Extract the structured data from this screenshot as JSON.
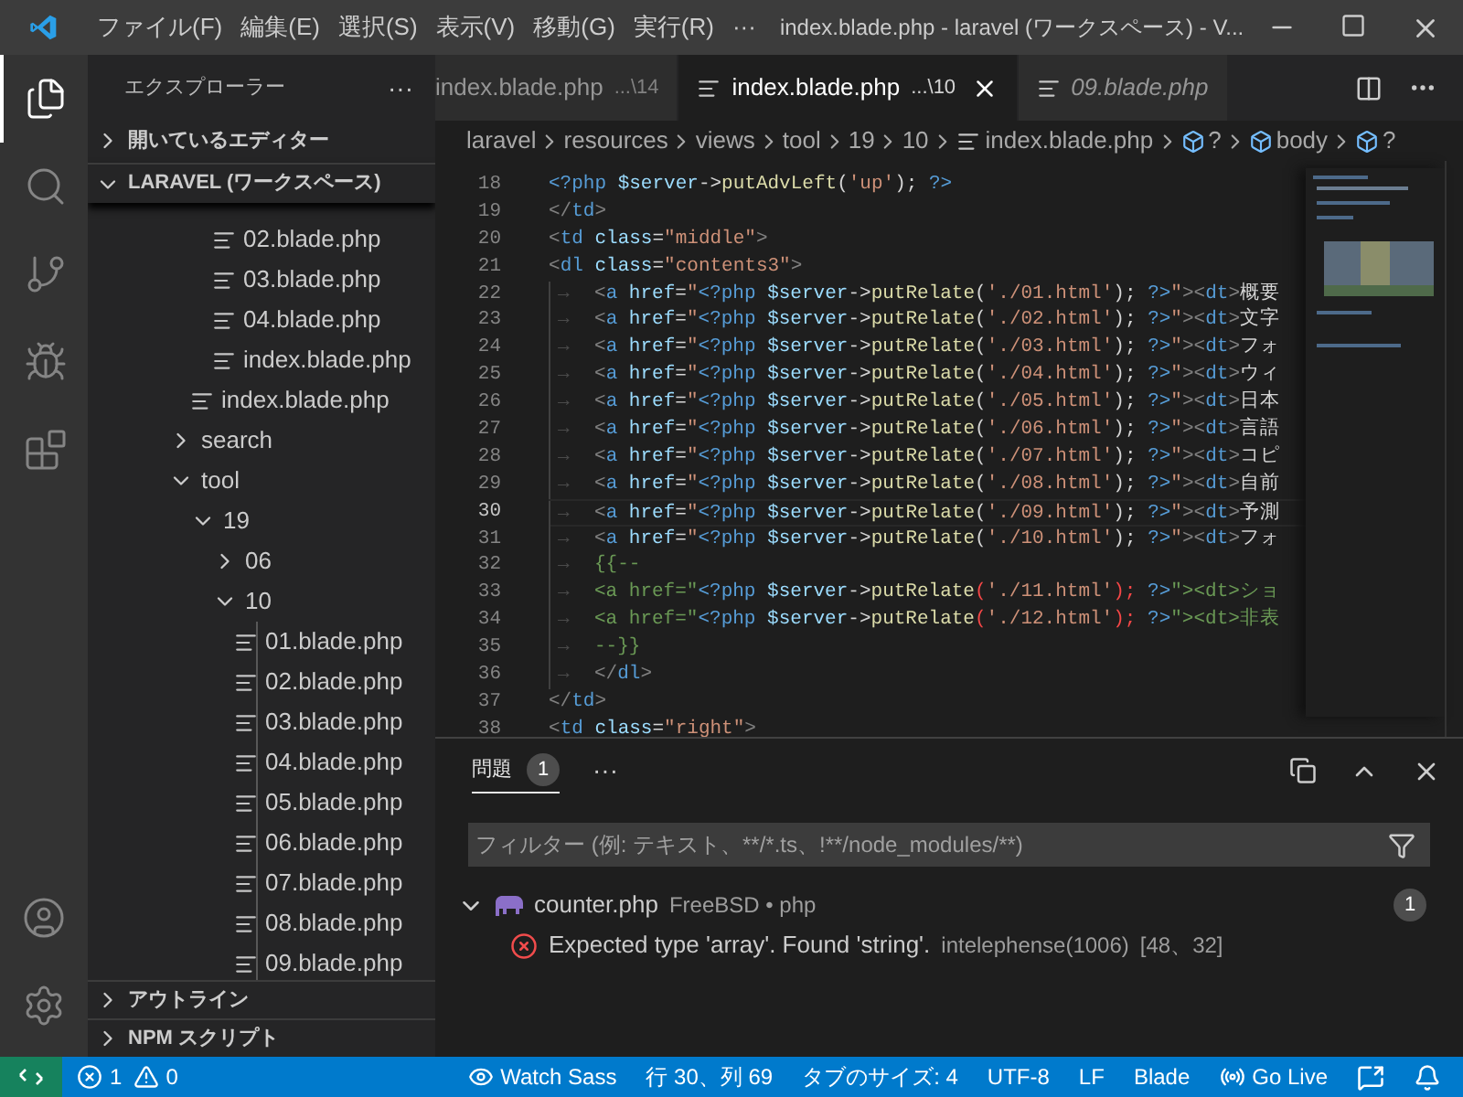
{
  "title_bar": {
    "menus": [
      {
        "label": "ファイル(F)"
      },
      {
        "label": "編集(E)"
      },
      {
        "label": "選択(S)"
      },
      {
        "label": "表示(V)"
      },
      {
        "label": "移動(G)"
      },
      {
        "label": "実行(R)"
      },
      {
        "label": "···"
      }
    ],
    "title": "index.blade.php - laravel (ワークスペース) - V..."
  },
  "activity_bar": {
    "items": [
      {
        "kind": "files",
        "selected": true
      },
      {
        "kind": "search",
        "selected": false
      },
      {
        "kind": "git",
        "selected": false
      },
      {
        "kind": "debug",
        "selected": false
      },
      {
        "kind": "extensions",
        "selected": false
      }
    ],
    "bottom": [
      {
        "kind": "account"
      },
      {
        "kind": "settings"
      }
    ]
  },
  "sidebar": {
    "title": "エクスプローラー",
    "more": "···",
    "open_editors": {
      "label": "開いているエディター",
      "expanded": false
    },
    "workspace": {
      "label": "LARAVEL (ワークスペース)",
      "expanded": true
    },
    "tree": [
      {
        "children": [
          {
            "children": [
              {
                "label": "02.blade.php"
              },
              {
                "label": "03.blade.php"
              },
              {
                "label": "04.blade.php"
              },
              {
                "label": "index.blade.php"
              }
            ]
          },
          {
            "label": "index.blade.php"
          }
        ]
      },
      {
        "label": "search",
        "expanded": false
      },
      {
        "label": "tool",
        "expanded": true,
        "children": [
          {
            "label": "19",
            "expanded": true,
            "children": [
              {
                "label": "06",
                "expanded": false
              },
              {
                "label": "10",
                "expanded": true,
                "children": [
                  {
                    "label": "01.blade.php"
                  },
                  {
                    "label": "02.blade.php"
                  },
                  {
                    "label": "03.blade.php"
                  },
                  {
                    "label": "04.blade.php"
                  },
                  {
                    "label": "05.blade.php"
                  },
                  {
                    "label": "06.blade.php"
                  },
                  {
                    "label": "07.blade.php"
                  },
                  {
                    "label": "08.blade.php"
                  },
                  {
                    "label": "09.blade.php"
                  }
                ]
              }
            ]
          }
        ]
      }
    ],
    "sections": [
      {
        "label": "アウトライン",
        "expanded": false
      },
      {
        "label": "NPM スクリプト",
        "expanded": false
      }
    ]
  },
  "tabs": [
    {
      "label": "index.blade.php",
      "path": "...\\14",
      "selected": false,
      "preview": false,
      "icon": false
    },
    {
      "label": "index.blade.php",
      "path": "...\\10",
      "selected": true,
      "preview": false,
      "icon": true
    },
    {
      "label": "09.blade.php",
      "selected": false,
      "preview": true,
      "icon": true
    }
  ],
  "breadcrumbs": [
    {
      "kind": "folder",
      "label": "laravel"
    },
    {
      "kind": "folder",
      "label": "resources"
    },
    {
      "kind": "folder",
      "label": "views"
    },
    {
      "kind": "folder",
      "label": "tool"
    },
    {
      "kind": "folder",
      "label": "19"
    },
    {
      "kind": "folder",
      "label": "10"
    },
    {
      "kind": "file",
      "label": "index.blade.php"
    },
    {
      "kind": "symbol",
      "label": "?"
    },
    {
      "kind": "symbol",
      "label": "body"
    },
    {
      "kind": "symbol",
      "label": "?"
    }
  ],
  "code": [
    {
      "number": "18",
      "current": false,
      "tokens": [
        {
          "kind": "keyword",
          "text": "<?php"
        },
        {
          "kind": "variable",
          "text": " $server"
        },
        {
          "kind": "operator",
          "text": "->"
        },
        {
          "kind": "function",
          "text": "putAdvLeft"
        },
        {
          "kind": "operator",
          "text": "("
        },
        {
          "kind": "string",
          "text": "'up'"
        },
        {
          "kind": "operator",
          "text": ");"
        },
        {
          "kind": "keyword",
          "text": " ?>"
        }
      ]
    },
    {
      "number": "19",
      "current": false,
      "tokens": [
        {
          "kind": "punct",
          "text": "</"
        },
        {
          "kind": "tag",
          "text": "td"
        },
        {
          "kind": "punct",
          "text": ">"
        }
      ]
    },
    {
      "number": "20",
      "current": false,
      "tokens": [
        {
          "kind": "punct",
          "text": "<"
        },
        {
          "kind": "tag",
          "text": "td"
        },
        {
          "kind": "attr",
          "text": " class"
        },
        {
          "kind": "operator",
          "text": "="
        },
        {
          "kind": "string",
          "text": "\"middle\""
        },
        {
          "kind": "punct",
          "text": ">"
        }
      ]
    },
    {
      "number": "21",
      "current": false,
      "tokens": [
        {
          "kind": "punct",
          "text": "<"
        },
        {
          "kind": "tag",
          "text": "dl"
        },
        {
          "kind": "attr",
          "text": " class"
        },
        {
          "kind": "operator",
          "text": "="
        },
        {
          "kind": "string",
          "text": "\"contents3\""
        },
        {
          "kind": "punct",
          "text": ">"
        }
      ]
    },
    {
      "number": "22",
      "current": false,
      "tokens": [
        {
          "kind": "tab",
          "text": "→"
        },
        {
          "kind": "punct",
          "text": "<"
        },
        {
          "kind": "tag",
          "text": "a"
        },
        {
          "kind": "attr",
          "text": " href"
        },
        {
          "kind": "operator",
          "text": "="
        },
        {
          "kind": "string",
          "text": "\""
        },
        {
          "kind": "keyword",
          "text": "<?php"
        },
        {
          "kind": "variable",
          "text": " $server"
        },
        {
          "kind": "operator",
          "text": "->"
        },
        {
          "kind": "function",
          "text": "putRelate"
        },
        {
          "kind": "operator",
          "text": "("
        },
        {
          "kind": "string",
          "text": "'./01.html'"
        },
        {
          "kind": "operator",
          "text": ");"
        },
        {
          "kind": "keyword",
          "text": " ?>"
        },
        {
          "kind": "string",
          "text": "\""
        },
        {
          "kind": "punct",
          "text": "><"
        },
        {
          "kind": "tag",
          "text": "dt"
        },
        {
          "kind": "punct",
          "text": ">"
        },
        {
          "kind": "text",
          "text": "概要"
        }
      ]
    },
    {
      "number": "23",
      "current": false,
      "tokens": [
        {
          "kind": "tab",
          "text": "→"
        },
        {
          "kind": "punct",
          "text": "<"
        },
        {
          "kind": "tag",
          "text": "a"
        },
        {
          "kind": "attr",
          "text": " href"
        },
        {
          "kind": "operator",
          "text": "="
        },
        {
          "kind": "string",
          "text": "\""
        },
        {
          "kind": "keyword",
          "text": "<?php"
        },
        {
          "kind": "variable",
          "text": " $server"
        },
        {
          "kind": "operator",
          "text": "->"
        },
        {
          "kind": "function",
          "text": "putRelate"
        },
        {
          "kind": "operator",
          "text": "("
        },
        {
          "kind": "string",
          "text": "'./02.html'"
        },
        {
          "kind": "operator",
          "text": ");"
        },
        {
          "kind": "keyword",
          "text": " ?>"
        },
        {
          "kind": "string",
          "text": "\""
        },
        {
          "kind": "punct",
          "text": "><"
        },
        {
          "kind": "tag",
          "text": "dt"
        },
        {
          "kind": "punct",
          "text": ">"
        },
        {
          "kind": "text",
          "text": "文字"
        }
      ]
    },
    {
      "number": "24",
      "current": false,
      "tokens": [
        {
          "kind": "tab",
          "text": "→"
        },
        {
          "kind": "punct",
          "text": "<"
        },
        {
          "kind": "tag",
          "text": "a"
        },
        {
          "kind": "attr",
          "text": " href"
        },
        {
          "kind": "operator",
          "text": "="
        },
        {
          "kind": "string",
          "text": "\""
        },
        {
          "kind": "keyword",
          "text": "<?php"
        },
        {
          "kind": "variable",
          "text": " $server"
        },
        {
          "kind": "operator",
          "text": "->"
        },
        {
          "kind": "function",
          "text": "putRelate"
        },
        {
          "kind": "operator",
          "text": "("
        },
        {
          "kind": "string",
          "text": "'./03.html'"
        },
        {
          "kind": "operator",
          "text": ");"
        },
        {
          "kind": "keyword",
          "text": " ?>"
        },
        {
          "kind": "string",
          "text": "\""
        },
        {
          "kind": "punct",
          "text": "><"
        },
        {
          "kind": "tag",
          "text": "dt"
        },
        {
          "kind": "punct",
          "text": ">"
        },
        {
          "kind": "text",
          "text": "フォ"
        }
      ]
    },
    {
      "number": "25",
      "current": false,
      "tokens": [
        {
          "kind": "tab",
          "text": "→"
        },
        {
          "kind": "punct",
          "text": "<"
        },
        {
          "kind": "tag",
          "text": "a"
        },
        {
          "kind": "attr",
          "text": " href"
        },
        {
          "kind": "operator",
          "text": "="
        },
        {
          "kind": "string",
          "text": "\""
        },
        {
          "kind": "keyword",
          "text": "<?php"
        },
        {
          "kind": "variable",
          "text": " $server"
        },
        {
          "kind": "operator",
          "text": "->"
        },
        {
          "kind": "function",
          "text": "putRelate"
        },
        {
          "kind": "operator",
          "text": "("
        },
        {
          "kind": "string",
          "text": "'./04.html'"
        },
        {
          "kind": "operator",
          "text": ");"
        },
        {
          "kind": "keyword",
          "text": " ?>"
        },
        {
          "kind": "string",
          "text": "\""
        },
        {
          "kind": "punct",
          "text": "><"
        },
        {
          "kind": "tag",
          "text": "dt"
        },
        {
          "kind": "punct",
          "text": ">"
        },
        {
          "kind": "text",
          "text": "ウィ"
        }
      ]
    },
    {
      "number": "26",
      "current": false,
      "tokens": [
        {
          "kind": "tab",
          "text": "→"
        },
        {
          "kind": "punct",
          "text": "<"
        },
        {
          "kind": "tag",
          "text": "a"
        },
        {
          "kind": "attr",
          "text": " href"
        },
        {
          "kind": "operator",
          "text": "="
        },
        {
          "kind": "string",
          "text": "\""
        },
        {
          "kind": "keyword",
          "text": "<?php"
        },
        {
          "kind": "variable",
          "text": " $server"
        },
        {
          "kind": "operator",
          "text": "->"
        },
        {
          "kind": "function",
          "text": "putRelate"
        },
        {
          "kind": "operator",
          "text": "("
        },
        {
          "kind": "string",
          "text": "'./05.html'"
        },
        {
          "kind": "operator",
          "text": ");"
        },
        {
          "kind": "keyword",
          "text": " ?>"
        },
        {
          "kind": "string",
          "text": "\""
        },
        {
          "kind": "punct",
          "text": "><"
        },
        {
          "kind": "tag",
          "text": "dt"
        },
        {
          "kind": "punct",
          "text": ">"
        },
        {
          "kind": "text",
          "text": "日本"
        }
      ]
    },
    {
      "number": "27",
      "current": false,
      "tokens": [
        {
          "kind": "tab",
          "text": "→"
        },
        {
          "kind": "punct",
          "text": "<"
        },
        {
          "kind": "tag",
          "text": "a"
        },
        {
          "kind": "attr",
          "text": " href"
        },
        {
          "kind": "operator",
          "text": "="
        },
        {
          "kind": "string",
          "text": "\""
        },
        {
          "kind": "keyword",
          "text": "<?php"
        },
        {
          "kind": "variable",
          "text": " $server"
        },
        {
          "kind": "operator",
          "text": "->"
        },
        {
          "kind": "function",
          "text": "putRelate"
        },
        {
          "kind": "operator",
          "text": "("
        },
        {
          "kind": "string",
          "text": "'./06.html'"
        },
        {
          "kind": "operator",
          "text": ");"
        },
        {
          "kind": "keyword",
          "text": " ?>"
        },
        {
          "kind": "string",
          "text": "\""
        },
        {
          "kind": "punct",
          "text": "><"
        },
        {
          "kind": "tag",
          "text": "dt"
        },
        {
          "kind": "punct",
          "text": ">"
        },
        {
          "kind": "text",
          "text": "言語"
        }
      ]
    },
    {
      "number": "28",
      "current": false,
      "tokens": [
        {
          "kind": "tab",
          "text": "→"
        },
        {
          "kind": "punct",
          "text": "<"
        },
        {
          "kind": "tag",
          "text": "a"
        },
        {
          "kind": "attr",
          "text": " href"
        },
        {
          "kind": "operator",
          "text": "="
        },
        {
          "kind": "string",
          "text": "\""
        },
        {
          "kind": "keyword",
          "text": "<?php"
        },
        {
          "kind": "variable",
          "text": " $server"
        },
        {
          "kind": "operator",
          "text": "->"
        },
        {
          "kind": "function",
          "text": "putRelate"
        },
        {
          "kind": "operator",
          "text": "("
        },
        {
          "kind": "string",
          "text": "'./07.html'"
        },
        {
          "kind": "operator",
          "text": ");"
        },
        {
          "kind": "keyword",
          "text": " ?>"
        },
        {
          "kind": "string",
          "text": "\""
        },
        {
          "kind": "punct",
          "text": "><"
        },
        {
          "kind": "tag",
          "text": "dt"
        },
        {
          "kind": "punct",
          "text": ">"
        },
        {
          "kind": "text",
          "text": "コピ"
        }
      ]
    },
    {
      "number": "29",
      "current": false,
      "tokens": [
        {
          "kind": "tab",
          "text": "→"
        },
        {
          "kind": "punct",
          "text": "<"
        },
        {
          "kind": "tag",
          "text": "a"
        },
        {
          "kind": "attr",
          "text": " href"
        },
        {
          "kind": "operator",
          "text": "="
        },
        {
          "kind": "string",
          "text": "\""
        },
        {
          "kind": "keyword",
          "text": "<?php"
        },
        {
          "kind": "variable",
          "text": " $server"
        },
        {
          "kind": "operator",
          "text": "->"
        },
        {
          "kind": "function",
          "text": "putRelate"
        },
        {
          "kind": "operator",
          "text": "("
        },
        {
          "kind": "string",
          "text": "'./08.html'"
        },
        {
          "kind": "operator",
          "text": ");"
        },
        {
          "kind": "keyword",
          "text": " ?>"
        },
        {
          "kind": "string",
          "text": "\""
        },
        {
          "kind": "punct",
          "text": "><"
        },
        {
          "kind": "tag",
          "text": "dt"
        },
        {
          "kind": "punct",
          "text": ">"
        },
        {
          "kind": "text",
          "text": "自前"
        }
      ]
    },
    {
      "number": "30",
      "current": true,
      "tokens": [
        {
          "kind": "tab",
          "text": "→"
        },
        {
          "kind": "punct",
          "text": "<"
        },
        {
          "kind": "tag",
          "text": "a"
        },
        {
          "kind": "attr",
          "text": " href"
        },
        {
          "kind": "operator",
          "text": "="
        },
        {
          "kind": "string",
          "text": "\""
        },
        {
          "kind": "keyword",
          "text": "<?php"
        },
        {
          "kind": "variable",
          "text": " $server"
        },
        {
          "kind": "operator",
          "text": "->"
        },
        {
          "kind": "function",
          "text": "putRelate"
        },
        {
          "kind": "operator",
          "text": "("
        },
        {
          "kind": "string",
          "text": "'./09.html'"
        },
        {
          "kind": "operator",
          "text": ");"
        },
        {
          "kind": "keyword",
          "text": " ?>"
        },
        {
          "kind": "string",
          "text": "\""
        },
        {
          "kind": "punct",
          "text": "><"
        },
        {
          "kind": "tag",
          "text": "dt"
        },
        {
          "kind": "punct",
          "text": ">"
        },
        {
          "kind": "text",
          "text": "予測"
        }
      ]
    },
    {
      "number": "31",
      "current": false,
      "tokens": [
        {
          "kind": "tab",
          "text": "→"
        },
        {
          "kind": "punct",
          "text": "<"
        },
        {
          "kind": "tag",
          "text": "a"
        },
        {
          "kind": "attr",
          "text": " href"
        },
        {
          "kind": "operator",
          "text": "="
        },
        {
          "kind": "string",
          "text": "\""
        },
        {
          "kind": "keyword",
          "text": "<?php"
        },
        {
          "kind": "variable",
          "text": " $server"
        },
        {
          "kind": "operator",
          "text": "->"
        },
        {
          "kind": "function",
          "text": "putRelate"
        },
        {
          "kind": "operator",
          "text": "("
        },
        {
          "kind": "string",
          "text": "'./10.html'"
        },
        {
          "kind": "operator",
          "text": ");"
        },
        {
          "kind": "keyword",
          "text": " ?>"
        },
        {
          "kind": "string",
          "text": "\""
        },
        {
          "kind": "punct",
          "text": "><"
        },
        {
          "kind": "tag",
          "text": "dt"
        },
        {
          "kind": "punct",
          "text": ">"
        },
        {
          "kind": "text",
          "text": "フォ"
        }
      ]
    },
    {
      "number": "32",
      "current": false,
      "tokens": [
        {
          "kind": "tab",
          "text": "→"
        },
        {
          "kind": "comment",
          "text": "{{--"
        }
      ]
    },
    {
      "number": "33",
      "current": false,
      "tokens": [
        {
          "kind": "tab",
          "text": "→"
        },
        {
          "kind": "comment",
          "text": "<a href=\""
        },
        {
          "kind": "keyword",
          "text": "<?php"
        },
        {
          "kind": "variable",
          "text": " $server"
        },
        {
          "kind": "operator",
          "text": "->"
        },
        {
          "kind": "function",
          "text": "putRelate"
        },
        {
          "kind": "bracket",
          "text": "("
        },
        {
          "kind": "string",
          "text": "'./11.html'"
        },
        {
          "kind": "bracket",
          "text": ");"
        },
        {
          "kind": "keyword",
          "text": " ?>"
        },
        {
          "kind": "comment",
          "text": "\"><dt>ショ"
        }
      ]
    },
    {
      "number": "34",
      "current": false,
      "tokens": [
        {
          "kind": "tab",
          "text": "→"
        },
        {
          "kind": "comment",
          "text": "<a href=\""
        },
        {
          "kind": "keyword",
          "text": "<?php"
        },
        {
          "kind": "variable",
          "text": " $server"
        },
        {
          "kind": "operator",
          "text": "->"
        },
        {
          "kind": "function",
          "text": "putRelate"
        },
        {
          "kind": "bracket",
          "text": "("
        },
        {
          "kind": "string",
          "text": "'./12.html'"
        },
        {
          "kind": "bracket",
          "text": ");"
        },
        {
          "kind": "keyword",
          "text": " ?>"
        },
        {
          "kind": "comment",
          "text": "\"><dt>非表"
        }
      ]
    },
    {
      "number": "35",
      "current": false,
      "tokens": [
        {
          "kind": "tab",
          "text": "→"
        },
        {
          "kind": "comment",
          "text": "--}}"
        }
      ]
    },
    {
      "number": "36",
      "current": false,
      "tokens": [
        {
          "kind": "tab",
          "text": "→"
        },
        {
          "kind": "punct",
          "text": "</"
        },
        {
          "kind": "tag",
          "text": "dl"
        },
        {
          "kind": "punct",
          "text": ">"
        }
      ]
    },
    {
      "number": "37",
      "current": false,
      "tokens": [
        {
          "kind": "punct",
          "text": "</"
        },
        {
          "kind": "tag",
          "text": "td"
        },
        {
          "kind": "punct",
          "text": ">"
        }
      ]
    },
    {
      "number": "38",
      "current": false,
      "tokens": [
        {
          "kind": "punct",
          "text": "<"
        },
        {
          "kind": "tag",
          "text": "td"
        },
        {
          "kind": "attr",
          "text": " class"
        },
        {
          "kind": "operator",
          "text": "="
        },
        {
          "kind": "string",
          "text": "\"right\""
        },
        {
          "kind": "punct",
          "text": ">"
        }
      ]
    }
  ],
  "panel": {
    "tabs": [
      {
        "label": "問題",
        "badge": "1",
        "selected": true
      }
    ],
    "more": "···",
    "filter": {
      "placeholder": "フィルター (例: テキスト、**/*.ts、!**/node_modules/**)"
    },
    "groups": [
      {
        "file": "counter.php",
        "location": "FreeBSD • php",
        "count": "1",
        "expanded": true,
        "problems": [
          {
            "kind": "error",
            "message": "Expected type 'array'. Found 'string'.",
            "source": "intelephense(1006)",
            "position": "[48、32]"
          }
        ]
      }
    ]
  },
  "status_bar": {
    "errors": "1",
    "warnings": "0",
    "items": [
      {
        "kind": "eye",
        "label": "Watch Sass"
      },
      {
        "kind": "text",
        "label": "行 30、列 69"
      },
      {
        "kind": "text",
        "label": "タブのサイズ: 4"
      },
      {
        "kind": "text",
        "label": "UTF-8"
      },
      {
        "kind": "text",
        "label": "LF"
      },
      {
        "kind": "text",
        "label": "Blade"
      },
      {
        "kind": "radio",
        "label": "Go Live"
      },
      {
        "kind": "feedback"
      },
      {
        "kind": "bell"
      }
    ]
  }
}
